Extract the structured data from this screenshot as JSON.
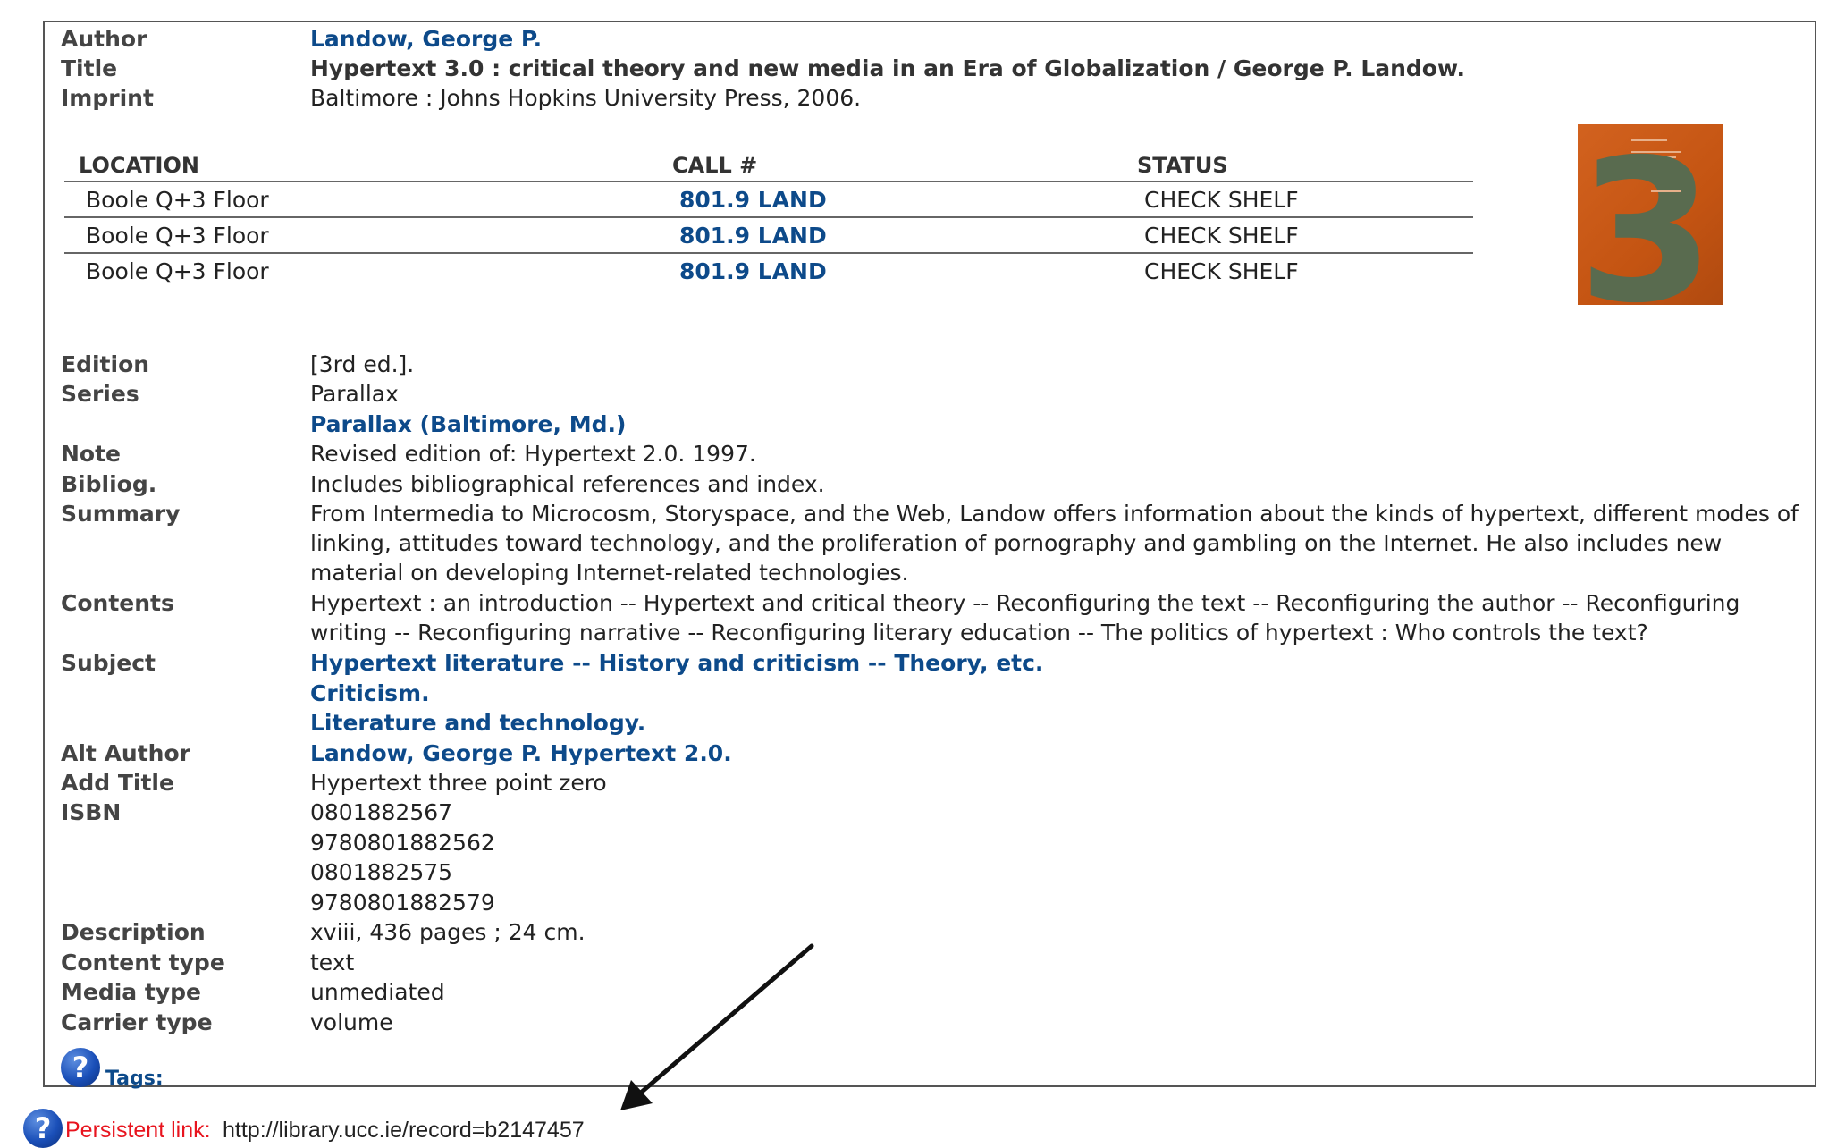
{
  "record": {
    "author_label": "Author",
    "author_value": "Landow, George P.",
    "title_label": "Title",
    "title_value": "Hypertext 3.0 : critical theory and new media in an Era of Globalization / George P. Landow.",
    "imprint_label": "Imprint",
    "imprint_value": "Baltimore : Johns Hopkins University Press, 2006."
  },
  "holdings": {
    "headers": {
      "location": "LOCATION",
      "call": "CALL #",
      "status": "STATUS"
    },
    "rows": [
      {
        "location": "Boole Q+3 Floor",
        "call": "801.9 LAND",
        "status": "CHECK SHELF"
      },
      {
        "location": "Boole Q+3 Floor",
        "call": "801.9 LAND",
        "status": "CHECK SHELF"
      },
      {
        "location": "Boole Q+3 Floor",
        "call": "801.9 LAND",
        "status": "CHECK SHELF"
      }
    ]
  },
  "cover": {
    "numeral": "3",
    "colors": {
      "background": "#c45412",
      "numeral": "#596b4f"
    }
  },
  "details": {
    "edition_label": "Edition",
    "edition_value": "[3rd ed.].",
    "series_label": "Series",
    "series_value": "Parallax",
    "series_link": "Parallax (Baltimore, Md.)",
    "note_label": "Note",
    "note_value": "Revised edition of: Hypertext 2.0. 1997.",
    "bibliog_label": "Bibliog.",
    "bibliog_value": "Includes bibliographical references and index.",
    "summary_label": "Summary",
    "summary_value": "From Intermedia to Microcosm, Storyspace, and the Web, Landow offers information about the kinds of hypertext, different modes of linking, attitudes toward technology, and the proliferation of pornography and gambling on the Internet. He also includes new material on developing Internet-related technologies.",
    "contents_label": "Contents",
    "contents_value": "Hypertext : an introduction -- Hypertext and critical theory -- Reconfiguring the text -- Reconfiguring the author -- Reconfiguring writing -- Reconfiguring narrative -- Reconfiguring literary education -- The politics of hypertext : Who controls the text?",
    "subject_label": "Subject",
    "subjects": [
      "Hypertext literature -- History and criticism -- Theory, etc.",
      "Criticism.",
      "Literature and technology."
    ],
    "alt_author_label": "Alt Author",
    "alt_author_value": "Landow, George P.  Hypertext 2.0.",
    "add_title_label": "Add Title",
    "add_title_value": "Hypertext three point zero",
    "isbn_label": "ISBN",
    "isbns": [
      "0801882567",
      "9780801882562",
      "0801882575",
      "9780801882579"
    ],
    "description_label": "Description",
    "description_value": "xviii, 436 pages ; 24 cm.",
    "content_type_label": "Content type",
    "content_type_value": "text",
    "media_type_label": "Media type",
    "media_type_value": "unmediated",
    "carrier_type_label": "Carrier type",
    "carrier_type_value": "volume"
  },
  "tags": {
    "icon": "?",
    "label": "Tags:"
  },
  "persistent": {
    "icon": "?",
    "label": "Persistent link:",
    "url": "http://library.ucc.ie/record=b2147457"
  },
  "colors": {
    "link": "#0d4a8a",
    "persistent_label": "#e8141e",
    "help_icon": "#1a4fb8"
  }
}
